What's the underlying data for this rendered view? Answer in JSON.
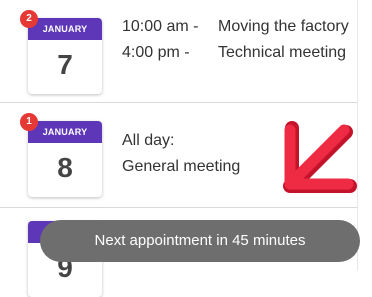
{
  "days": [
    {
      "month": "JANUARY",
      "day": "7",
      "badge": "2",
      "events": [
        {
          "time": "10:00 am -",
          "title": "Moving the factory"
        },
        {
          "time": "4:00 pm -",
          "title": "Technical meeting"
        }
      ]
    },
    {
      "month": "JANUARY",
      "day": "8",
      "badge": "1",
      "events": [
        {
          "time": "All day:",
          "title": "General meeting"
        }
      ]
    },
    {
      "day": "9"
    }
  ],
  "toast": "Next appointment in 45 minutes",
  "colors": {
    "calendar_header": "#5e36b8",
    "badge": "#e53935",
    "arrow": "#e8203a",
    "toast_bg": "#6e6e6e"
  },
  "icons": {
    "arrow": "down-left-arrow-icon"
  }
}
